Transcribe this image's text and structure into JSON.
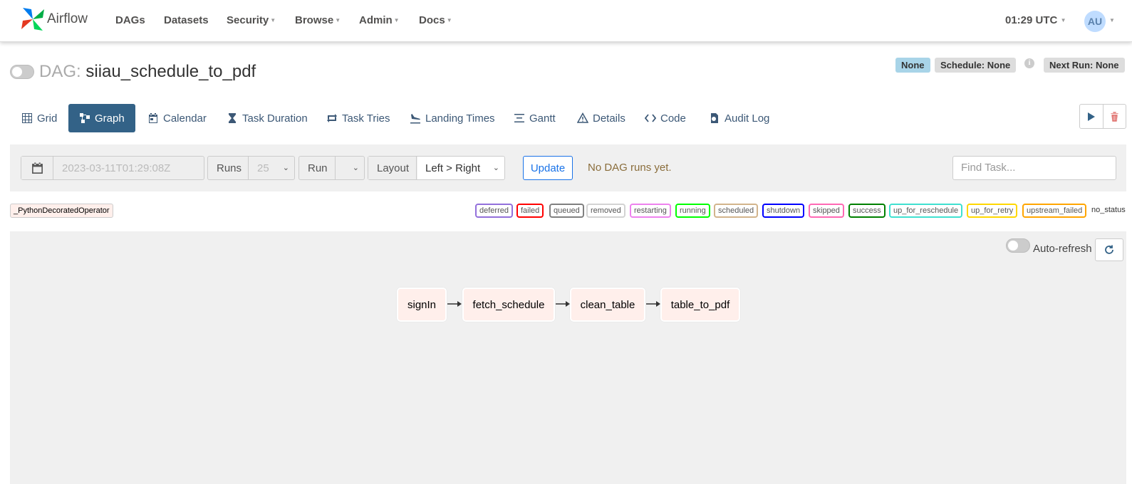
{
  "navbar": {
    "brand": "Airflow",
    "items": [
      "DAGs",
      "Datasets",
      "Security",
      "Browse",
      "Admin",
      "Docs"
    ],
    "time": "01:29 UTC",
    "user_initials": "AU"
  },
  "dag": {
    "prefix": "DAG:",
    "name": "siiau_schedule_to_pdf",
    "paused": true,
    "badges": {
      "none": "None",
      "schedule": "Schedule: None",
      "next_run": "Next Run: None"
    }
  },
  "tabs": [
    {
      "label": "Grid",
      "icon": "grid-icon",
      "active": false
    },
    {
      "label": "Graph",
      "icon": "graph-icon",
      "active": true
    },
    {
      "label": "Calendar",
      "icon": "calendar-icon",
      "active": false
    },
    {
      "label": "Task Duration",
      "icon": "hourglass-icon",
      "active": false
    },
    {
      "label": "Task Tries",
      "icon": "retry-icon",
      "active": false
    },
    {
      "label": "Landing Times",
      "icon": "landing-plane-icon",
      "active": false
    },
    {
      "label": "Gantt",
      "icon": "gantt-icon",
      "active": false
    },
    {
      "label": "Details",
      "icon": "warning-triangle-icon",
      "active": false
    },
    {
      "label": "Code",
      "icon": "code-icon",
      "active": false
    },
    {
      "label": "Audit Log",
      "icon": "file-search-icon",
      "active": false
    }
  ],
  "filters": {
    "base_date": "2023-03-11T01:29:08Z",
    "runs_label": "Runs",
    "runs_value": "25",
    "run_label": "Run",
    "run_value": "",
    "layout_label": "Layout",
    "layout_value": "Left > Right",
    "update_label": "Update",
    "no_runs_text": "No DAG runs yet.",
    "find_task_placeholder": "Find Task..."
  },
  "legend": {
    "operator": "_PythonDecoratedOperator",
    "states": [
      {
        "label": "deferred",
        "color": "#9370db"
      },
      {
        "label": "failed",
        "color": "#ff0000"
      },
      {
        "label": "queued",
        "color": "#808080"
      },
      {
        "label": "removed",
        "color": "#d3d3d3"
      },
      {
        "label": "restarting",
        "color": "#ee82ee"
      },
      {
        "label": "running",
        "color": "#00ff00"
      },
      {
        "label": "scheduled",
        "color": "#d2b48c"
      },
      {
        "label": "shutdown",
        "color": "#0000ff"
      },
      {
        "label": "skipped",
        "color": "#ff69b4"
      },
      {
        "label": "success",
        "color": "#008000"
      },
      {
        "label": "up_for_reschedule",
        "color": "#40e0d0"
      },
      {
        "label": "up_for_retry",
        "color": "#ffd700"
      },
      {
        "label": "upstream_failed",
        "color": "#ffa500"
      }
    ],
    "no_status": "no_status"
  },
  "graph": {
    "auto_refresh_label": "Auto-refresh",
    "auto_refresh_on": false,
    "nodes": [
      "signIn",
      "fetch_schedule",
      "clean_table",
      "table_to_pdf"
    ]
  },
  "colors": {
    "active_tab": "#336287",
    "operator_bg": "#ffefeb",
    "link": "#1a73e8"
  }
}
